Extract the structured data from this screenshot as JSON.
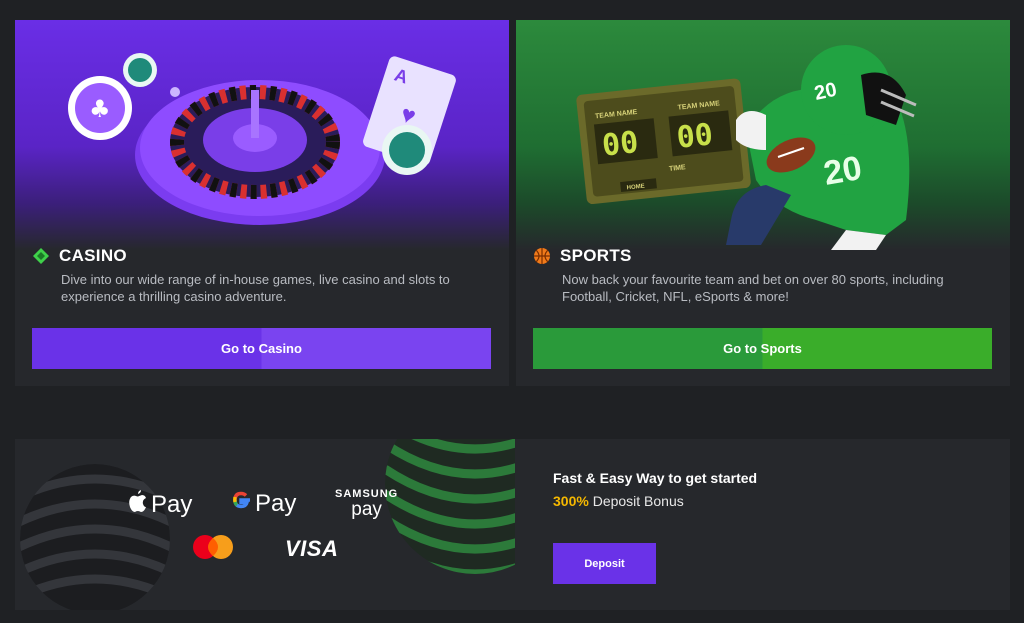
{
  "casino": {
    "title": "CASINO",
    "description": "Dive into our wide range of in-house games, live casino and slots to experience a thrilling casino adventure.",
    "button_label": "Go to Casino",
    "accent": "#6a32e8"
  },
  "sports": {
    "title": "SPORTS",
    "description": "Now back your favourite team and bet on over 80 sports, including Football, Cricket, NFL, eSports & more!",
    "button_label": "Go to Sports",
    "accent": "#2a9a3a",
    "scoreboard": {
      "team_left": "TEAM NAME",
      "team_right": "TEAM NAME",
      "score_left": "00",
      "score_right": "00",
      "time": "TIME",
      "home": "HOME"
    },
    "jersey_number": "20"
  },
  "payments": {
    "apple_pay": "Pay",
    "google_pay": "Pay",
    "samsung_top": "SAMSUNG",
    "samsung_bottom": "pay",
    "visa": "VISA"
  },
  "promo": {
    "headline": "Fast & Easy Way to get started",
    "bonus_percent": "300%",
    "bonus_text": " Deposit Bonus",
    "deposit_label": "Deposit",
    "bonus_color": "#f5b800"
  }
}
